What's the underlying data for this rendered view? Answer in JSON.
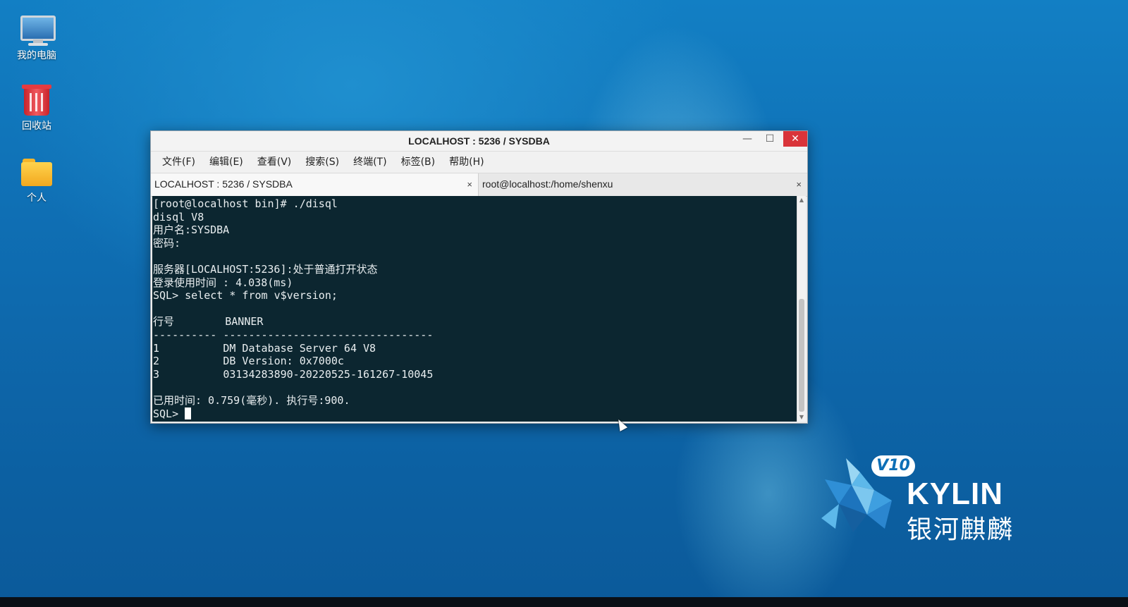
{
  "desktop": {
    "icons": [
      {
        "label": "我的电脑",
        "icon": "computer-icon"
      },
      {
        "label": "回收站",
        "icon": "trash-icon"
      },
      {
        "label": "个人",
        "icon": "folder-home-icon"
      }
    ],
    "logo": {
      "badge": "V10",
      "name": "KYLIN",
      "name_cn": "银河麒麟"
    }
  },
  "window": {
    "title": "LOCALHOST : 5236 / SYSDBA",
    "controls": {
      "minimize": "—",
      "maximize": "☐",
      "close": "✕"
    },
    "menu": [
      "文件(F)",
      "编辑(E)",
      "查看(V)",
      "搜索(S)",
      "终端(T)",
      "标签(B)",
      "帮助(H)"
    ],
    "tabs": [
      {
        "label": "LOCALHOST : 5236 / SYSDBA",
        "active": true,
        "close": "×"
      },
      {
        "label": "root@localhost:/home/shenxu",
        "active": false,
        "close": "×"
      }
    ],
    "terminal": {
      "lines": [
        "[root@localhost bin]# ./disql",
        "disql V8",
        "用户名:SYSDBA",
        "密码:",
        "",
        "服务器[LOCALHOST:5236]:处于普通打开状态",
        "登录使用时间 : 4.038(ms)",
        "SQL> select * from v$version;",
        "",
        "行号        BANNER",
        "---------- ---------------------------------",
        "1          DM Database Server 64 V8",
        "2          DB Version: 0x7000c",
        "3          03134283890-20220525-161267-10045",
        "",
        "已用时间: 0.759(毫秒). 执行号:900."
      ],
      "prompt": "SQL> "
    },
    "scrollbar": {
      "up": "▲",
      "down": "▼"
    }
  },
  "colors": {
    "terminal_bg": "#0c2630",
    "terminal_fg": "#e9eef0",
    "close_button": "#d9343a",
    "desktop_blue": "#0f6fb4"
  }
}
